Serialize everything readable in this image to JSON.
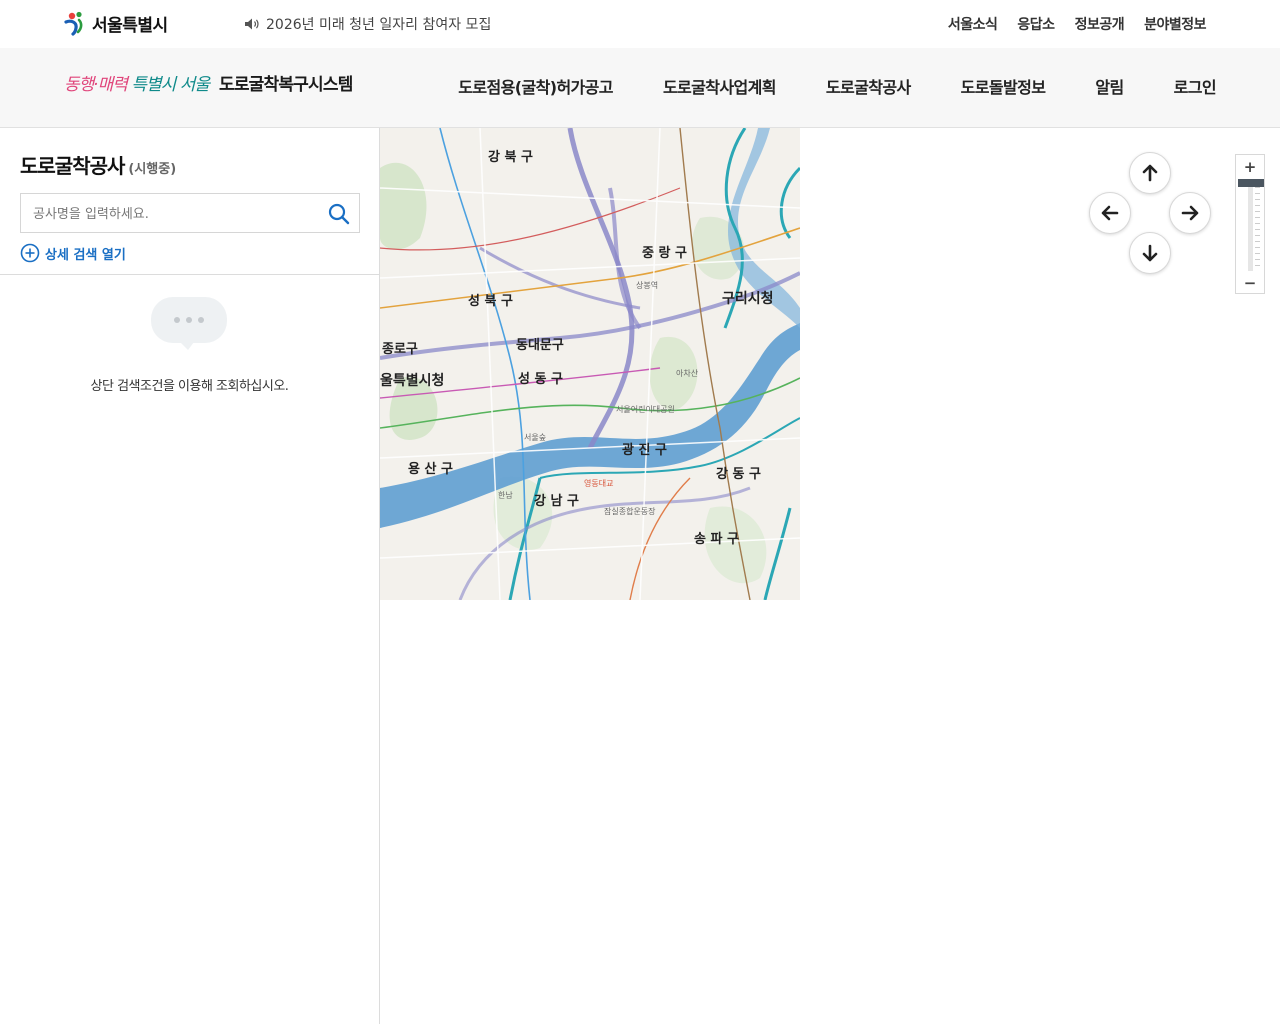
{
  "topbar": {
    "logo_text": "서울특별시",
    "notice": "2026년 미래 청년 일자리 참여자 모집",
    "links": [
      "서울소식",
      "응답소",
      "정보공개",
      "분야별정보"
    ]
  },
  "header": {
    "slogan_a": "동행·매력",
    "slogan_b": "특별시 서울",
    "title": "도로굴착복구시스템",
    "nav": [
      "도로점용(굴착)허가공고",
      "도로굴착사업계획",
      "도로굴착공사",
      "도로돌발정보",
      "알림",
      "로그인"
    ]
  },
  "panel": {
    "title": "도로굴착공사",
    "subtitle": "(시행중)",
    "search_placeholder": "공사명을 입력하세요.",
    "detail_search": "상세 검색 열기",
    "empty_message": "상단 검색조건을 이용해 조회하십시오."
  },
  "map": {
    "labels": {
      "gangbuk": "강 북 구",
      "jungnang": "중 랑 구",
      "guri": "구리시청",
      "seongbuk": "성 북 구",
      "dongdaemun": "동대문구",
      "jongno": "종로구",
      "seoul_hall": "울특별시청",
      "seongdong": "성 동 구",
      "gwangjin": "광 진 구",
      "yongsan": "용 산 구",
      "gangdong": "강 동 구",
      "gangnam": "강 남 구",
      "songpa": "송 파 구",
      "achasan": "아차산",
      "sangbong": "상봉역",
      "ttukseom": "서울어린이대공원",
      "yeongdong": "영동대교",
      "hannam": "한남",
      "jamsil": "잠실종합운동장",
      "seoul_forest": "서울숲"
    },
    "colors": {
      "river": "#5f9fd1",
      "road_main": "#8a88c9",
      "highway": "#2ba7b5",
      "park": "#cfe2c4"
    }
  }
}
